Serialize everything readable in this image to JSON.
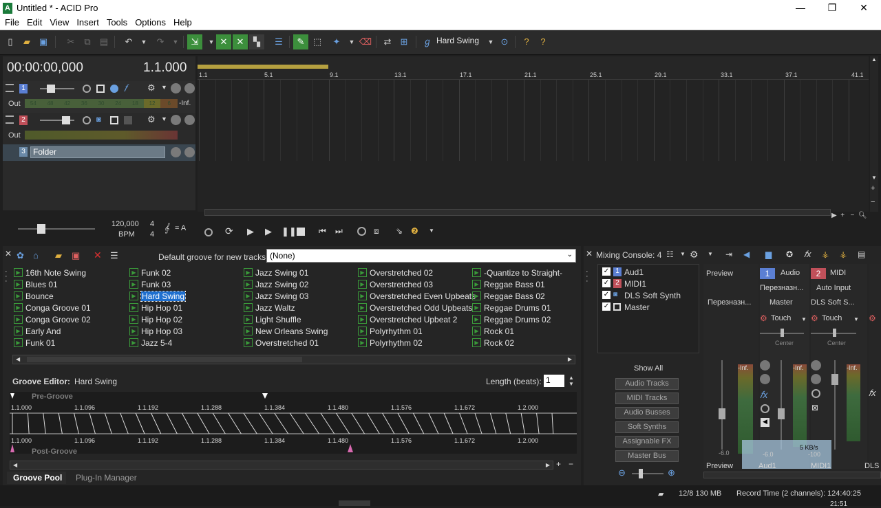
{
  "window": {
    "title": "Untitled * - ACID Pro",
    "app_letter": "A",
    "minimize": "—",
    "maximize": "❐",
    "close": "✕"
  },
  "menu": [
    "File",
    "Edit",
    "View",
    "Insert",
    "Tools",
    "Options",
    "Help"
  ],
  "toolbar": {
    "groove_name": "Hard Swing"
  },
  "time": {
    "timecode": "00:00:00,000",
    "measure": "1.1.000"
  },
  "tracks": [
    {
      "num": "1",
      "color": "#5b7fd3",
      "out_label": "Out",
      "meter_ticks": [
        "54",
        "48",
        "42",
        "36",
        "30",
        "24",
        "18",
        "12",
        "6"
      ],
      "level": "-Inf."
    },
    {
      "num": "2",
      "color": "#c0505a",
      "out_label": "Out"
    },
    {
      "num": "3",
      "color": "#6b8aa8",
      "name": "Folder"
    }
  ],
  "ruler": [
    "1.1",
    "5.1",
    "9.1",
    "13.1",
    "17.1",
    "21.1",
    "25.1",
    "29.1",
    "33.1",
    "37.1",
    "41.1"
  ],
  "tempo": {
    "bpm_value": "120,000",
    "bpm_label": "BPM",
    "sig_top": "4",
    "sig_bottom": "4",
    "key": "= A"
  },
  "groove": {
    "default_label": "Default groove for new tracks:",
    "default_value": "(None)",
    "columns": [
      [
        "16th Note Swing",
        "Blues 01",
        "Bounce",
        "Conga Groove 01",
        "Conga Groove 02",
        "Early And",
        "Funk 01"
      ],
      [
        "Funk 02",
        "Funk 03",
        "Hard Swing",
        "Hip Hop 01",
        "Hip Hop 02",
        "Hip Hop 03",
        "Jazz 5-4"
      ],
      [
        "Jazz Swing 01",
        "Jazz Swing 02",
        "Jazz Swing 03",
        "Jazz Waltz",
        "Light Shuffle",
        "New Orleans Swing",
        "Overstretched 01"
      ],
      [
        "Overstretched 02",
        "Overstretched 03",
        "Overstretched Even Upbeats",
        "Overstretched Odd Upbeats",
        "Overstretched Upbeat 2",
        "Polyrhythm 01",
        "Polyrhythm 02"
      ],
      [
        "-Quantize to Straight-",
        "Reggae Bass 01",
        "Reggae Bass 02",
        "Reggae Drums 01",
        "Reggae Drums 02",
        "Rock 01",
        "Rock 02"
      ]
    ],
    "selected": "Hard Swing",
    "editor_label": "Groove Editor:",
    "editor_name": "Hard Swing",
    "length_label": "Length (beats):",
    "length_value": "1",
    "pre_label": "Pre-Groove",
    "post_label": "Post-Groove",
    "ticks": [
      "1.1.000",
      "1.1.096",
      "1.1.192",
      "1.1.288",
      "1.1.384",
      "1.1.480",
      "1.1.576",
      "1.1.672",
      "1.2.000"
    ]
  },
  "tabs": {
    "groove_pool": "Groove Pool",
    "plugin_manager": "Plug-In Manager"
  },
  "mixer": {
    "title": "Mixing Console: 4",
    "items": [
      {
        "num": "1",
        "name": "Aud1"
      },
      {
        "num": "2",
        "name": "MIDI1"
      },
      {
        "num": "",
        "name": "DLS Soft Synth"
      },
      {
        "num": "",
        "name": "Master"
      }
    ],
    "show_all": "Show All",
    "buttons": [
      "Audio Tracks",
      "MIDI Tracks",
      "Audio Busses",
      "Soft Synths",
      "Assignable FX",
      "Master Bus"
    ],
    "preview": "Preview",
    "preview_sub": "Перезназн...",
    "strip1": {
      "num": "1",
      "name": "Audio",
      "route": "Перезназн...",
      "bus": "Master",
      "mode": "Touch",
      "pan": "Center",
      "db": "-Inf."
    },
    "strip2": {
      "num": "2",
      "name": "MIDI",
      "route": "Auto Input",
      "bus": "DLS Soft S...",
      "mode": "Touch",
      "pan": "Center",
      "db": "-Inf."
    },
    "strip3": {
      "name": "DLS"
    },
    "fader_db": "-6.0",
    "fader_db2": "-6.0",
    "fader_db3": "-100",
    "net": "5 KB/s",
    "bottom": {
      "preview": "Preview",
      "aud": "Aud1",
      "midi": "MIDI1",
      "dls": "DLS"
    }
  },
  "status": {
    "memory": "12/8 130 MB",
    "record_time": "Record Time (2 channels): 124:40:25",
    "clock": "21:51"
  }
}
